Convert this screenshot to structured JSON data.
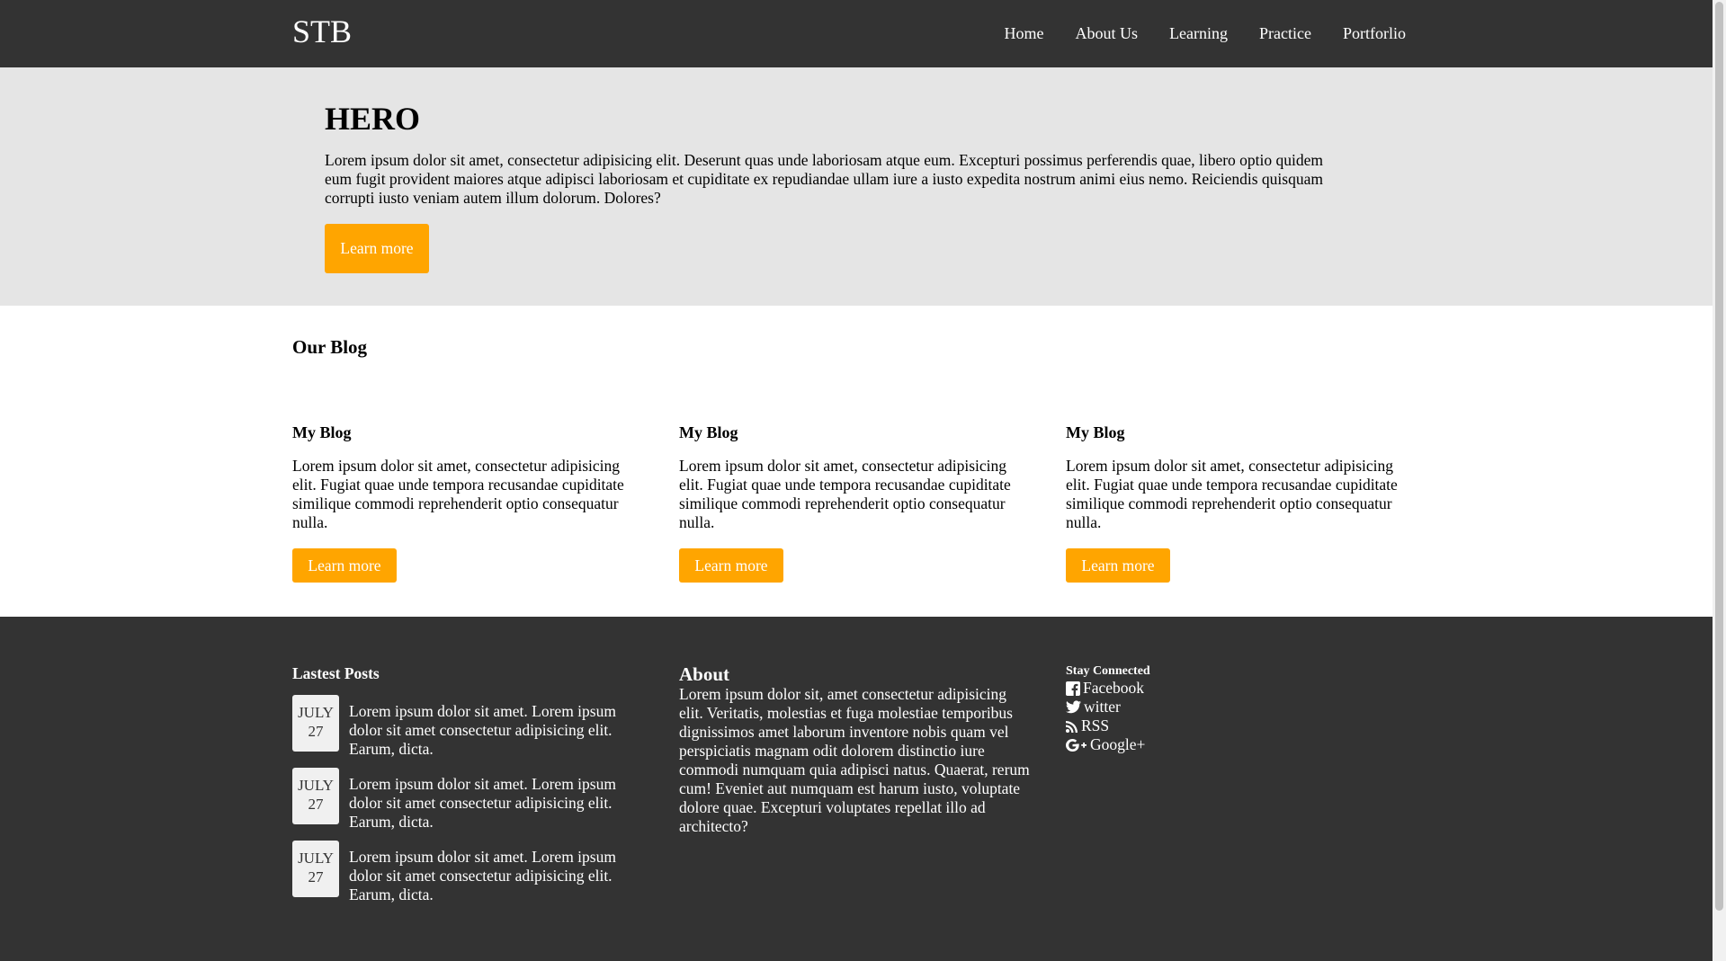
{
  "header": {
    "brand": "STB",
    "nav": [
      "Home",
      "About Us",
      "Learning",
      "Practice",
      "Portforlio"
    ]
  },
  "hero": {
    "title": "HERO",
    "text": "Lorem ipsum dolor sit amet, consectetur adipisicing elit. Deserunt quas unde laboriosam atque eum. Excepturi possimus perferendis quae, libero optio quidem eum fugit provident maiores atque adipisci laboriosam et cupiditate ex repudiandae ullam iure a iusto expedita nostrum animi eius nemo. Reiciendis quisquam corrupti iusto veniam autem illum dolorum. Dolores?",
    "button": "Learn more"
  },
  "blog": {
    "heading": "Our Blog",
    "cards": [
      {
        "title": "My Blog",
        "text": "Lorem ipsum dolor sit amet, consectetur adipisicing elit. Fugiat quae unde tempora recusandae cupiditate similique commodi reprehenderit optio consequatur nulla.",
        "button": "Learn more"
      },
      {
        "title": "My Blog",
        "text": "Lorem ipsum dolor sit amet, consectetur adipisicing elit. Fugiat quae unde tempora recusandae cupiditate similique commodi reprehenderit optio consequatur nulla.",
        "button": "Learn more"
      },
      {
        "title": "My Blog",
        "text": "Lorem ipsum dolor sit amet, consectetur adipisicing elit. Fugiat quae unde tempora recusandae cupiditate similique commodi reprehenderit optio consequatur nulla.",
        "button": "Learn more"
      }
    ]
  },
  "footer": {
    "posts_heading": "Lastest Posts",
    "posts": [
      {
        "month": "JULY",
        "day": "27",
        "text": "Lorem ipsum dolor sit amet. Lorem ipsum dolor sit amet consectetur adipisicing elit. Earum, dicta."
      },
      {
        "month": "JULY",
        "day": "27",
        "text": "Lorem ipsum dolor sit amet. Lorem ipsum dolor sit amet consectetur adipisicing elit. Earum, dicta."
      },
      {
        "month": "JULY",
        "day": "27",
        "text": "Lorem ipsum dolor sit amet. Lorem ipsum dolor sit amet consectetur adipisicing elit. Earum, dicta."
      }
    ],
    "about_heading": "About",
    "about_text": "Lorem ipsum dolor sit, amet consectetur adipisicing elit. Veritatis, molestias et fuga molestiae temporibus dignissimos amet laborum inventore nobis quam vel perspiciatis magnam odit dolorem distinctio iure commodi numquam quia adipisci natus. Quaerat, rerum cum! Eveniet aut numquam est harum iusto, voluptate dolore quae. Excepturi voluptates repellat illo ad architecto?",
    "social_heading": "Stay Connected",
    "social": [
      {
        "icon": "facebook-icon",
        "label": "Facebook"
      },
      {
        "icon": "twitter-icon",
        "label": "witter"
      },
      {
        "icon": "rss-icon",
        "label": "RSS"
      },
      {
        "icon": "google-plus-icon",
        "label": "Google+"
      }
    ]
  },
  "colors": {
    "dark": "#333333",
    "hero_bg": "#e5e5e5",
    "accent": "#ffa500"
  }
}
